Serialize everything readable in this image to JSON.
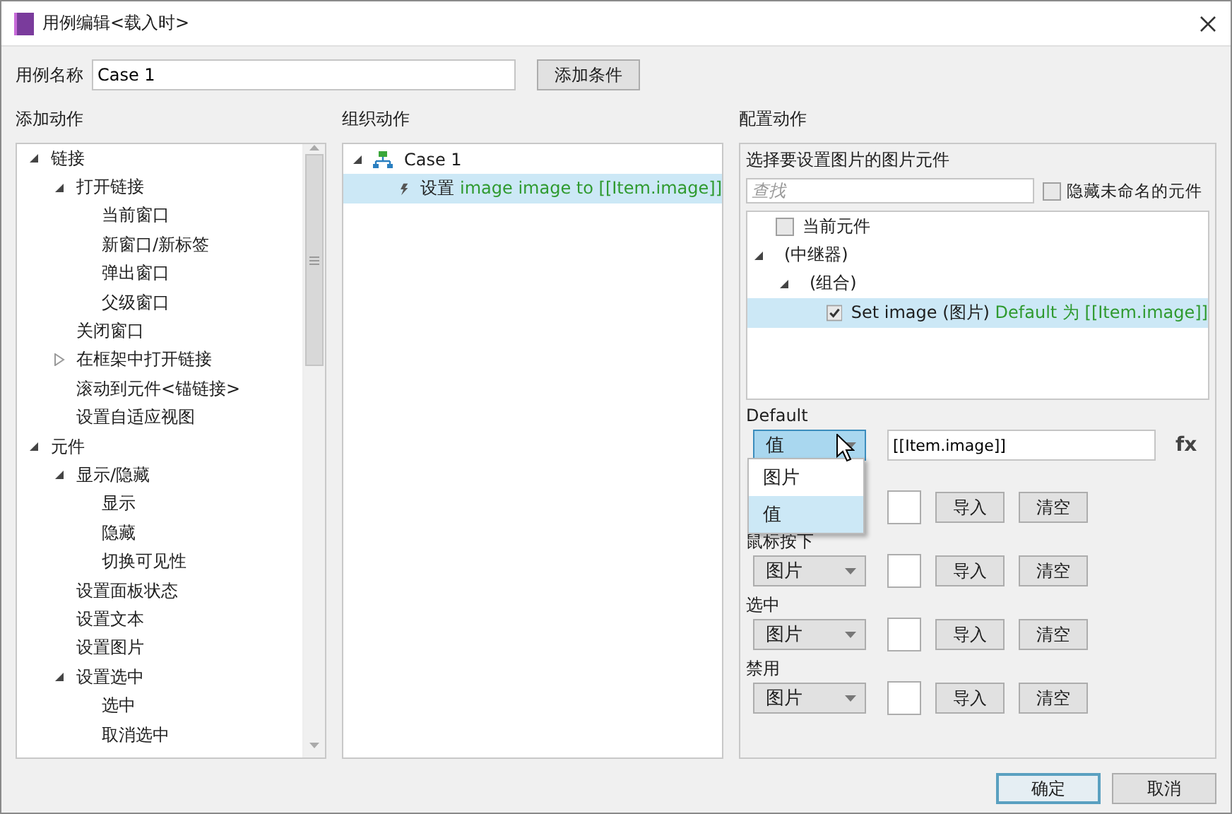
{
  "window": {
    "title": "用例编辑<载入时>"
  },
  "case_name": {
    "label": "用例名称",
    "value": "Case 1"
  },
  "add_condition_button": "添加条件",
  "add_actions": {
    "title": "添加动作",
    "tree": [
      {
        "label": "链接",
        "expanded": true,
        "children": [
          {
            "label": "打开链接",
            "expanded": true,
            "children": [
              {
                "label": "当前窗口"
              },
              {
                "label": "新窗口/新标签"
              },
              {
                "label": "弹出窗口"
              },
              {
                "label": "父级窗口"
              }
            ]
          },
          {
            "label": "关闭窗口"
          },
          {
            "label": "在框架中打开链接",
            "expanded": false
          },
          {
            "label": "滚动到元件<锚链接>"
          },
          {
            "label": "设置自适应视图"
          }
        ]
      },
      {
        "label": "元件",
        "expanded": true,
        "children": [
          {
            "label": "显示/隐藏",
            "expanded": true,
            "children": [
              {
                "label": "显示"
              },
              {
                "label": "隐藏"
              },
              {
                "label": "切换可见性"
              }
            ]
          },
          {
            "label": "设置面板状态"
          },
          {
            "label": "设置文本"
          },
          {
            "label": "设置图片"
          },
          {
            "label": "设置选中",
            "expanded": true,
            "children": [
              {
                "label": "选中"
              },
              {
                "label": "取消选中"
              }
            ]
          }
        ]
      }
    ]
  },
  "organize_actions": {
    "title": "组织动作",
    "cases": [
      {
        "label": "Case 1",
        "expanded": true,
        "actions": [
          {
            "verb": "设置",
            "detail": "image image to [[Item.image]]",
            "selected": true
          }
        ]
      }
    ]
  },
  "configure_actions": {
    "title": "配置动作",
    "target_label": "选择要设置图片的图片元件",
    "search": {
      "placeholder": "查找"
    },
    "hide_unnamed": {
      "label": "隐藏未命名的元件",
      "checked": false
    },
    "widget_tree": [
      {
        "kind": "checkbox",
        "label": "当前元件",
        "checked": false,
        "selected": false
      },
      {
        "kind": "group",
        "label": "(中继器)",
        "expanded": true,
        "children": [
          {
            "kind": "group",
            "label": "(组合)",
            "expanded": true,
            "children": [
              {
                "kind": "checkbox",
                "label": "Set image (图片)",
                "detail": "Default 为 [[Item.image]]",
                "checked": true,
                "selected": true
              }
            ]
          }
        ]
      }
    ],
    "default": {
      "label": "Default",
      "select": "值",
      "value": "[[Item.image]]",
      "fx": "fx",
      "options": [
        {
          "label": "图片",
          "selected": false
        },
        {
          "label": "值",
          "selected": true
        }
      ]
    },
    "states": [
      {
        "import": "导入",
        "clear": "清空"
      },
      {
        "label": "鼠标按下",
        "select": "图片",
        "import": "导入",
        "clear": "清空"
      },
      {
        "label": "选中",
        "select": "图片",
        "import": "导入",
        "clear": "清空"
      },
      {
        "label": "禁用",
        "select": "图片",
        "import": "导入",
        "clear": "清空"
      }
    ]
  },
  "buttons": [
    {
      "label": "确定",
      "kind": "primary"
    },
    {
      "label": "取消",
      "kind": "normal"
    }
  ]
}
